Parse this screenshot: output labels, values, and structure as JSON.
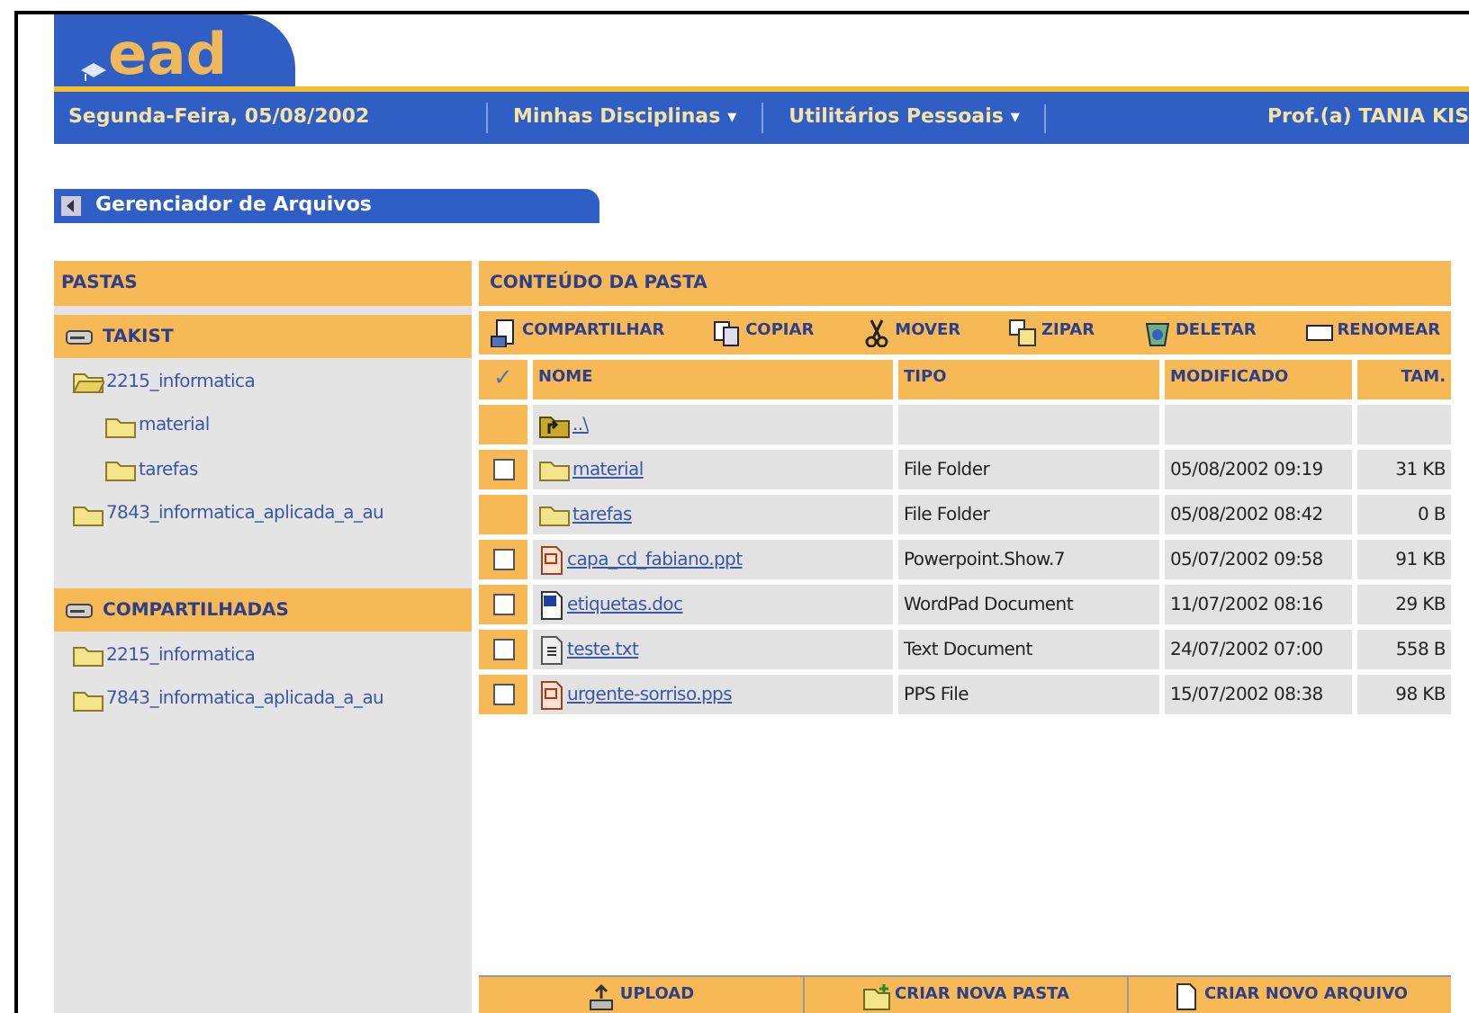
{
  "logo": {
    "text": "ead"
  },
  "nav": {
    "date": "Segunda-Feira, 05/08/2002",
    "menus": [
      {
        "label": "Minhas Disciplinas",
        "caret": "▾"
      },
      {
        "label": "Utilitários Pessoais",
        "caret": "▾"
      }
    ],
    "user": "Prof.(a) TANIA KIS"
  },
  "section_tab": {
    "title": "Gerenciador de Arquivos"
  },
  "folders_panel": {
    "title": "PASTAS",
    "groups": [
      {
        "title": "TAKIST",
        "items": [
          {
            "label": "2215_informatica",
            "expanded": true,
            "children": [
              {
                "label": "material",
                "expanded": false
              },
              {
                "label": "tarefas",
                "expanded": false
              }
            ]
          },
          {
            "label": "7843_informatica_aplicada_a_au",
            "expanded": false
          }
        ]
      },
      {
        "title": "COMPARTILHADAS",
        "items": [
          {
            "label": "2215_informatica",
            "expanded": false
          },
          {
            "label": "7843_informatica_aplicada_a_au",
            "expanded": false
          }
        ]
      }
    ]
  },
  "content": {
    "title": "CONTEÚDO DA PASTA",
    "toolbar": [
      {
        "kind": "share",
        "label": "COMPARTILHAR"
      },
      {
        "kind": "copy",
        "label": "COPIAR"
      },
      {
        "kind": "move",
        "label": "MOVER"
      },
      {
        "kind": "zip",
        "label": "ZIPAR"
      },
      {
        "kind": "delete",
        "label": "DELETAR"
      },
      {
        "kind": "rename",
        "label": "RENOMEAR"
      }
    ],
    "table": {
      "check_column": "✓",
      "columns": [
        "NOME",
        "TIPO",
        "MODIFICADO",
        "TAM."
      ],
      "rows": [
        {
          "kind": "up",
          "selectable": false,
          "checked": false,
          "name": "..\\",
          "type": "",
          "modified": "",
          "size": ""
        },
        {
          "kind": "folder",
          "selectable": true,
          "checked": false,
          "name": "material",
          "type": "File Folder",
          "modified": "05/08/2002 09:19",
          "size": "31 KB"
        },
        {
          "kind": "folder",
          "selectable": false,
          "checked": false,
          "name": "tarefas",
          "type": "File Folder",
          "modified": "05/08/2002 08:42",
          "size": "0 B"
        },
        {
          "kind": "slides",
          "selectable": true,
          "checked": false,
          "name": "capa_cd_fabiano.ppt",
          "type": "Powerpoint.Show.7",
          "modified": "05/07/2002 09:58",
          "size": "91 KB"
        },
        {
          "kind": "doc",
          "selectable": true,
          "checked": false,
          "name": "etiquetas.doc",
          "type": "WordPad Document",
          "modified": "11/07/2002 08:16",
          "size": "29 KB"
        },
        {
          "kind": "text",
          "selectable": true,
          "checked": false,
          "name": "teste.txt",
          "type": "Text Document",
          "modified": "24/07/2002 07:00",
          "size": "558 B"
        },
        {
          "kind": "slides",
          "selectable": true,
          "checked": false,
          "name": "urgente-sorriso.pps",
          "type": "PPS File",
          "modified": "15/07/2002 08:38",
          "size": "98 KB"
        }
      ]
    },
    "footer": [
      {
        "kind": "upload",
        "label": "UPLOAD"
      },
      {
        "kind": "new_folder",
        "label": "CRIAR NOVA PASTA"
      },
      {
        "kind": "new_file",
        "label": "CRIAR NOVO ARQUIVO"
      }
    ]
  }
}
